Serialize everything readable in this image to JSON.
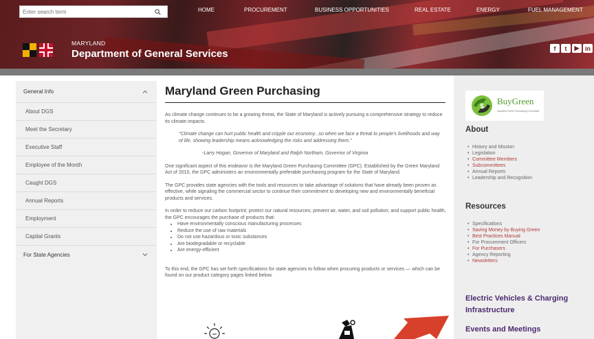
{
  "search": {
    "placeholder": "Enter search term"
  },
  "nav": {
    "home": "HOME",
    "procurement": "PROCUREMENT",
    "business": "BUSINESS OPPORTUNITIES",
    "real_estate": "REAL ESTATE",
    "energy": "ENERGY",
    "fuel": "FUEL MANAGEMENT"
  },
  "agency": {
    "state": "MARYLAND",
    "dept": "Department of General Services"
  },
  "social": {
    "facebook": "f",
    "twitter": "t",
    "youtube": "▶",
    "linkedin": "in"
  },
  "sidebar": {
    "items": [
      "General Info",
      "About DGS",
      "Meet the Secretary",
      "Executive Staff",
      "Employee of the Month",
      "Caught DGS",
      "Annual Reports",
      "Employment",
      "Capital Grants",
      "For State Agencies"
    ]
  },
  "main": {
    "title": "Maryland Green Purchasing",
    "p1": "As climate change continues to be a growing threat, the State of Maryland is actively pursuing a comprehensive strategy to reduce its climate impacts.",
    "quote": "\"Climate change can hurt public health and cripple our economy...so when we face a threat to people's livelihoods and way of life, showing leadership means acknowledging the risks and addressing them.\"",
    "attribution": "-Larry Hogan, Governor of Maryland and Ralph Northam, Governor of Virginia",
    "p2": "One significant aspect of this endeavor is the Maryland Green Purchasing Committee (GPC). Established by the Green Maryland Act of 2010, the GPC administers an environmentally preferable purchasing program for the State of Maryland.",
    "p3": "The GPC provides state agencies with the tools and resources to take advantage of solutions that have already been proven as effective, while signaling the commercial sector to continue their commitment to developing new and environmentally beneficial products and services.",
    "p4": "In order to reduce our carbon footprint; protect our natural resources; prevent air, water, and soil pollution; and support public health, the GPC encourages the purchase of products that:",
    "bullets": [
      "Have environmentally conscious manufacturing processes",
      "Reduce the use of raw materials",
      "Do not use hazardous or toxic substances",
      "Are biodegradable or recyclable",
      "Are energy-efficient"
    ],
    "p5": "To this end, the GPC has set forth specifications for state agencies to follow when procuring products or services — which can be found on our product category pages linked below."
  },
  "right": {
    "logo_text": "BuyGreen",
    "logo_tagline": "Maryland Green Purchasing Committee",
    "about_heading": "About",
    "about_items": [
      "History and Mission",
      "Legislation",
      "Committee Members",
      "Subcommittees",
      "Annual Reports",
      "Leadership and Recognition"
    ],
    "resources_heading": "Resources",
    "resources_items": [
      "Specifications",
      "Saving Money by Buying Green",
      "Best Practices Manual",
      "For Procurement Officers",
      "For Purchasers",
      "Agency Reporting",
      "Newsletters"
    ],
    "ev_link": "Electric Vehicles & Charging Infrastructure",
    "events_link": "Events and Meetings"
  }
}
